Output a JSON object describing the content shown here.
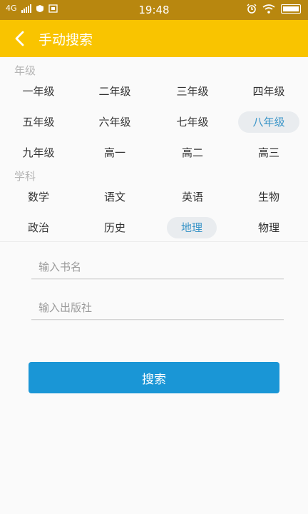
{
  "status_bar": {
    "network": "4G",
    "time": "19:48",
    "icons": [
      "signal-icon",
      "notification-icon",
      "app-icon",
      "alarm-icon",
      "wifi-icon",
      "battery-icon"
    ]
  },
  "header": {
    "back_icon": "chevron-left-icon",
    "title": "手动搜索",
    "background": "#f9c400"
  },
  "grade_section": {
    "label": "年级",
    "items": [
      "一年级",
      "二年级",
      "三年级",
      "四年级",
      "五年级",
      "六年级",
      "七年级",
      "八年级",
      "九年级",
      "高一",
      "高二",
      "高三"
    ],
    "selected": "八年级"
  },
  "subject_section": {
    "label": "学科",
    "items": [
      "数学",
      "语文",
      "英语",
      "生物",
      "政治",
      "历史",
      "地理",
      "物理"
    ],
    "selected": "地理"
  },
  "form": {
    "book_name_placeholder": "输入书名",
    "publisher_placeholder": "输入出版社",
    "search_label": "搜索"
  },
  "colors": {
    "accent": "#1a96d6",
    "selected_text": "#3a95c8",
    "status_bar": "#b8870f"
  }
}
